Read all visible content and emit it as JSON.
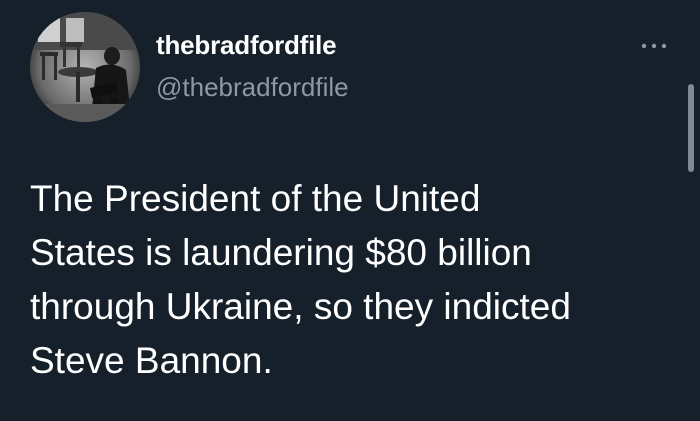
{
  "tweet": {
    "display_name": "thebradfordfile",
    "handle": "@thebradfordfile",
    "text": "The President of the United\nStates is laundering $80 billion\nthrough Ukraine, so they indicted\nSteve Bannon."
  },
  "icons": {
    "more": "more-horizontal-icon",
    "avatar": "profile-photo"
  },
  "colors": {
    "background": "#15202b",
    "primary_text": "#ffffff",
    "secondary_text": "#8b98a5"
  }
}
